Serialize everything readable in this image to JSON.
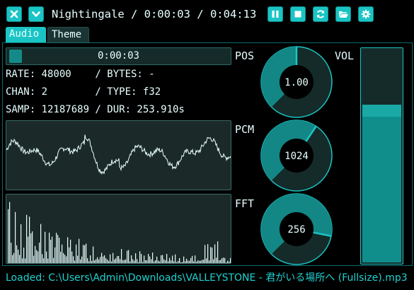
{
  "window": {
    "title": "Nightingale / 0:00:03 / 0:04:13"
  },
  "tabs": [
    {
      "label": "Audio",
      "active": true
    },
    {
      "label": "Theme",
      "active": false
    }
  ],
  "toolbar": {
    "close_icon": "close-icon",
    "menu_icon": "chevron-down-icon",
    "pause_icon": "pause-icon",
    "stop_icon": "stop-icon",
    "loop_icon": "refresh-icon",
    "open_icon": "folder-open-icon",
    "settings_icon": "gear-icon"
  },
  "position": {
    "label": "0:00:03",
    "progress": 0.012
  },
  "info": {
    "line1": "RATE: 48000    / BYTES: -",
    "line2": "CHAN: 2        / TYPE: f32",
    "line3": "SAMP: 12187689 / DUR: 253.910s"
  },
  "side_labels": {
    "pos": "POS",
    "pcm": "PCM",
    "fft": "FFT",
    "vol": "VOL"
  },
  "knobs": {
    "pos": {
      "value": "1.00",
      "fraction": 0.5
    },
    "pcm": {
      "value": "1024",
      "fraction": 0.625
    },
    "fft": {
      "value": "256",
      "fraction": 0.875
    }
  },
  "volume": {
    "fraction": 0.74
  },
  "status": "Loaded: C:\\Users\\Admin\\Downloads\\VALLEYSTONE - 君がいる場所へ (Fullsize).mp3",
  "colors": {
    "accent": "#1bc4c4",
    "panel": "#1b2a28",
    "text": "#e9ffff",
    "status": "#1fd2d0"
  }
}
